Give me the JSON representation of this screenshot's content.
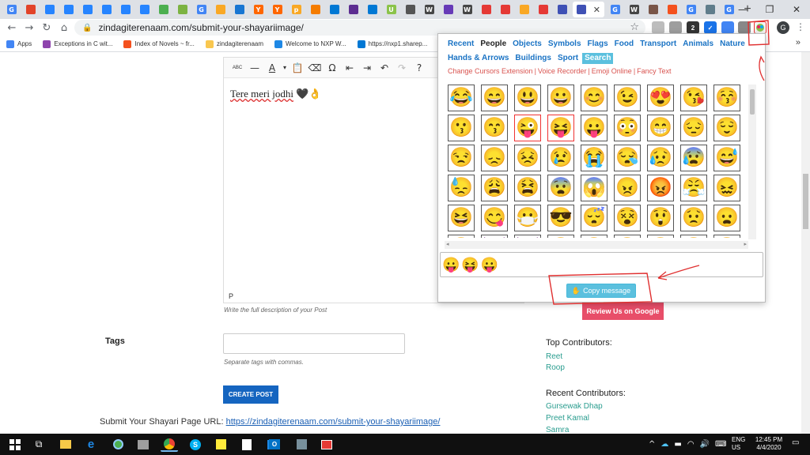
{
  "browser": {
    "tabs": [
      {
        "glyph": "G",
        "color": "#4285f4"
      },
      {
        "glyph": "",
        "color": "#e24329"
      },
      {
        "glyph": "",
        "color": "#2684ff"
      },
      {
        "glyph": "",
        "color": "#2684ff"
      },
      {
        "glyph": "",
        "color": "#2684ff"
      },
      {
        "glyph": "",
        "color": "#2684ff"
      },
      {
        "glyph": "",
        "color": "#2684ff"
      },
      {
        "glyph": "",
        "color": "#2684ff"
      },
      {
        "glyph": "",
        "color": "#4caf50"
      },
      {
        "glyph": "",
        "color": "#7cb342"
      },
      {
        "glyph": "G",
        "color": "#4285f4"
      },
      {
        "glyph": "",
        "color": "#f9a825"
      },
      {
        "glyph": "",
        "color": "#1976d2"
      },
      {
        "glyph": "Y",
        "color": "#ff6600"
      },
      {
        "glyph": "Y",
        "color": "#ff6600"
      },
      {
        "glyph": "p",
        "color": "#f9a825"
      },
      {
        "glyph": "",
        "color": "#f57c00"
      },
      {
        "glyph": "",
        "color": "#0078d4"
      },
      {
        "glyph": "",
        "color": "#5c2d91"
      },
      {
        "glyph": "",
        "color": "#0078d4"
      },
      {
        "glyph": "U",
        "color": "#8bc34a"
      },
      {
        "glyph": "",
        "color": "#555555"
      },
      {
        "glyph": "W",
        "color": "#464646"
      },
      {
        "glyph": "",
        "color": "#673ab7"
      },
      {
        "glyph": "W",
        "color": "#464646"
      },
      {
        "glyph": "",
        "color": "#e53935"
      },
      {
        "glyph": "",
        "color": "#e53935"
      },
      {
        "glyph": "",
        "color": "#f9a825"
      },
      {
        "glyph": "",
        "color": "#e53935"
      },
      {
        "glyph": "",
        "color": "#3f51b5"
      }
    ],
    "active_tab": {
      "glyph": "",
      "color": "#3f51b5",
      "close": "✕"
    },
    "tabs_after": [
      {
        "glyph": "G",
        "color": "#4285f4"
      },
      {
        "glyph": "W",
        "color": "#464646"
      },
      {
        "glyph": "",
        "color": "#795548"
      },
      {
        "glyph": "",
        "color": "#f4511e"
      },
      {
        "glyph": "G",
        "color": "#4285f4"
      },
      {
        "glyph": "",
        "color": "#607d8b"
      },
      {
        "glyph": "G",
        "color": "#4285f4"
      }
    ],
    "new_tab": "+",
    "url": "zindagiterenaam.com/submit-your-shayariimage/",
    "badge_count": "2",
    "avatar_letter": "G",
    "bookmarks": [
      {
        "label": "Apps",
        "color": "#4285f4"
      },
      {
        "label": "Exceptions in C wit...",
        "color": "#8e44ad"
      },
      {
        "label": "Index of Novels ~ fr...",
        "color": "#f4511e"
      },
      {
        "label": "zindagiterenaam",
        "color": "#f9c74f"
      },
      {
        "label": "Welcome to NXP W...",
        "color": "#1e88e5"
      },
      {
        "label": "https://nxp1.sharep...",
        "color": "#0078d4"
      }
    ],
    "bookmarks_more": "»"
  },
  "page": {
    "editor_text": "Tere meri jodhi",
    "editor_emoji": "🖤👌",
    "editor_path": "P",
    "description_hint": "Write the full description of your Post",
    "tags_label": "Tags",
    "tags_hint": "Separate tags with commas.",
    "create_button": "CREATE POST",
    "url_label": "Submit Your Shayari Page URL:",
    "url_link": "https://zindagiterenaam.com/submit-your-shayariimage/",
    "review_button": "Review Us on Google",
    "top_contributors_title": "Top Contributors:",
    "top_contributors": [
      "Reet",
      "Roop"
    ],
    "recent_contributors_title": "Recent Contributors:",
    "recent_contributors": [
      "Gursewak Dhap",
      "Preet Kamal",
      "Samra"
    ]
  },
  "popup": {
    "categories": [
      "Recent",
      "People",
      "Objects",
      "Symbols",
      "Flags",
      "Food",
      "Transport",
      "Animals",
      "Nature",
      "Hands & Arrows",
      "Buildings",
      "Sport",
      "Search"
    ],
    "current_category": "People",
    "links": [
      "Change Cursors Extension",
      "Voice Recorder",
      "Emoji Online",
      "Fancy Text"
    ],
    "emojis": [
      "😂",
      "😄",
      "😃",
      "😀",
      "😊",
      "😉",
      "😍",
      "😘",
      "😚",
      "😗",
      "😙",
      "😜",
      "😝",
      "😛",
      "😳",
      "😁",
      "😔",
      "😌",
      "😒",
      "😞",
      "😣",
      "😢",
      "😭",
      "😪",
      "😥",
      "😰",
      "😅",
      "😓",
      "😩",
      "😫",
      "😨",
      "😱",
      "😠",
      "😡",
      "😤",
      "😖",
      "😆",
      "😋",
      "😷",
      "😎",
      "😴",
      "😵",
      "😲",
      "😟",
      "😦",
      "😧",
      "😈",
      "👿",
      "😮",
      "😬",
      "😐",
      "😕",
      "😯",
      "😶"
    ],
    "highlighted": [
      11,
      12
    ],
    "message": "😛😝😛",
    "copy_button": "Copy message"
  },
  "taskbar": {
    "lang": "ENG",
    "region": "US",
    "time": "12:45 PM",
    "date": "4/4/2020"
  }
}
